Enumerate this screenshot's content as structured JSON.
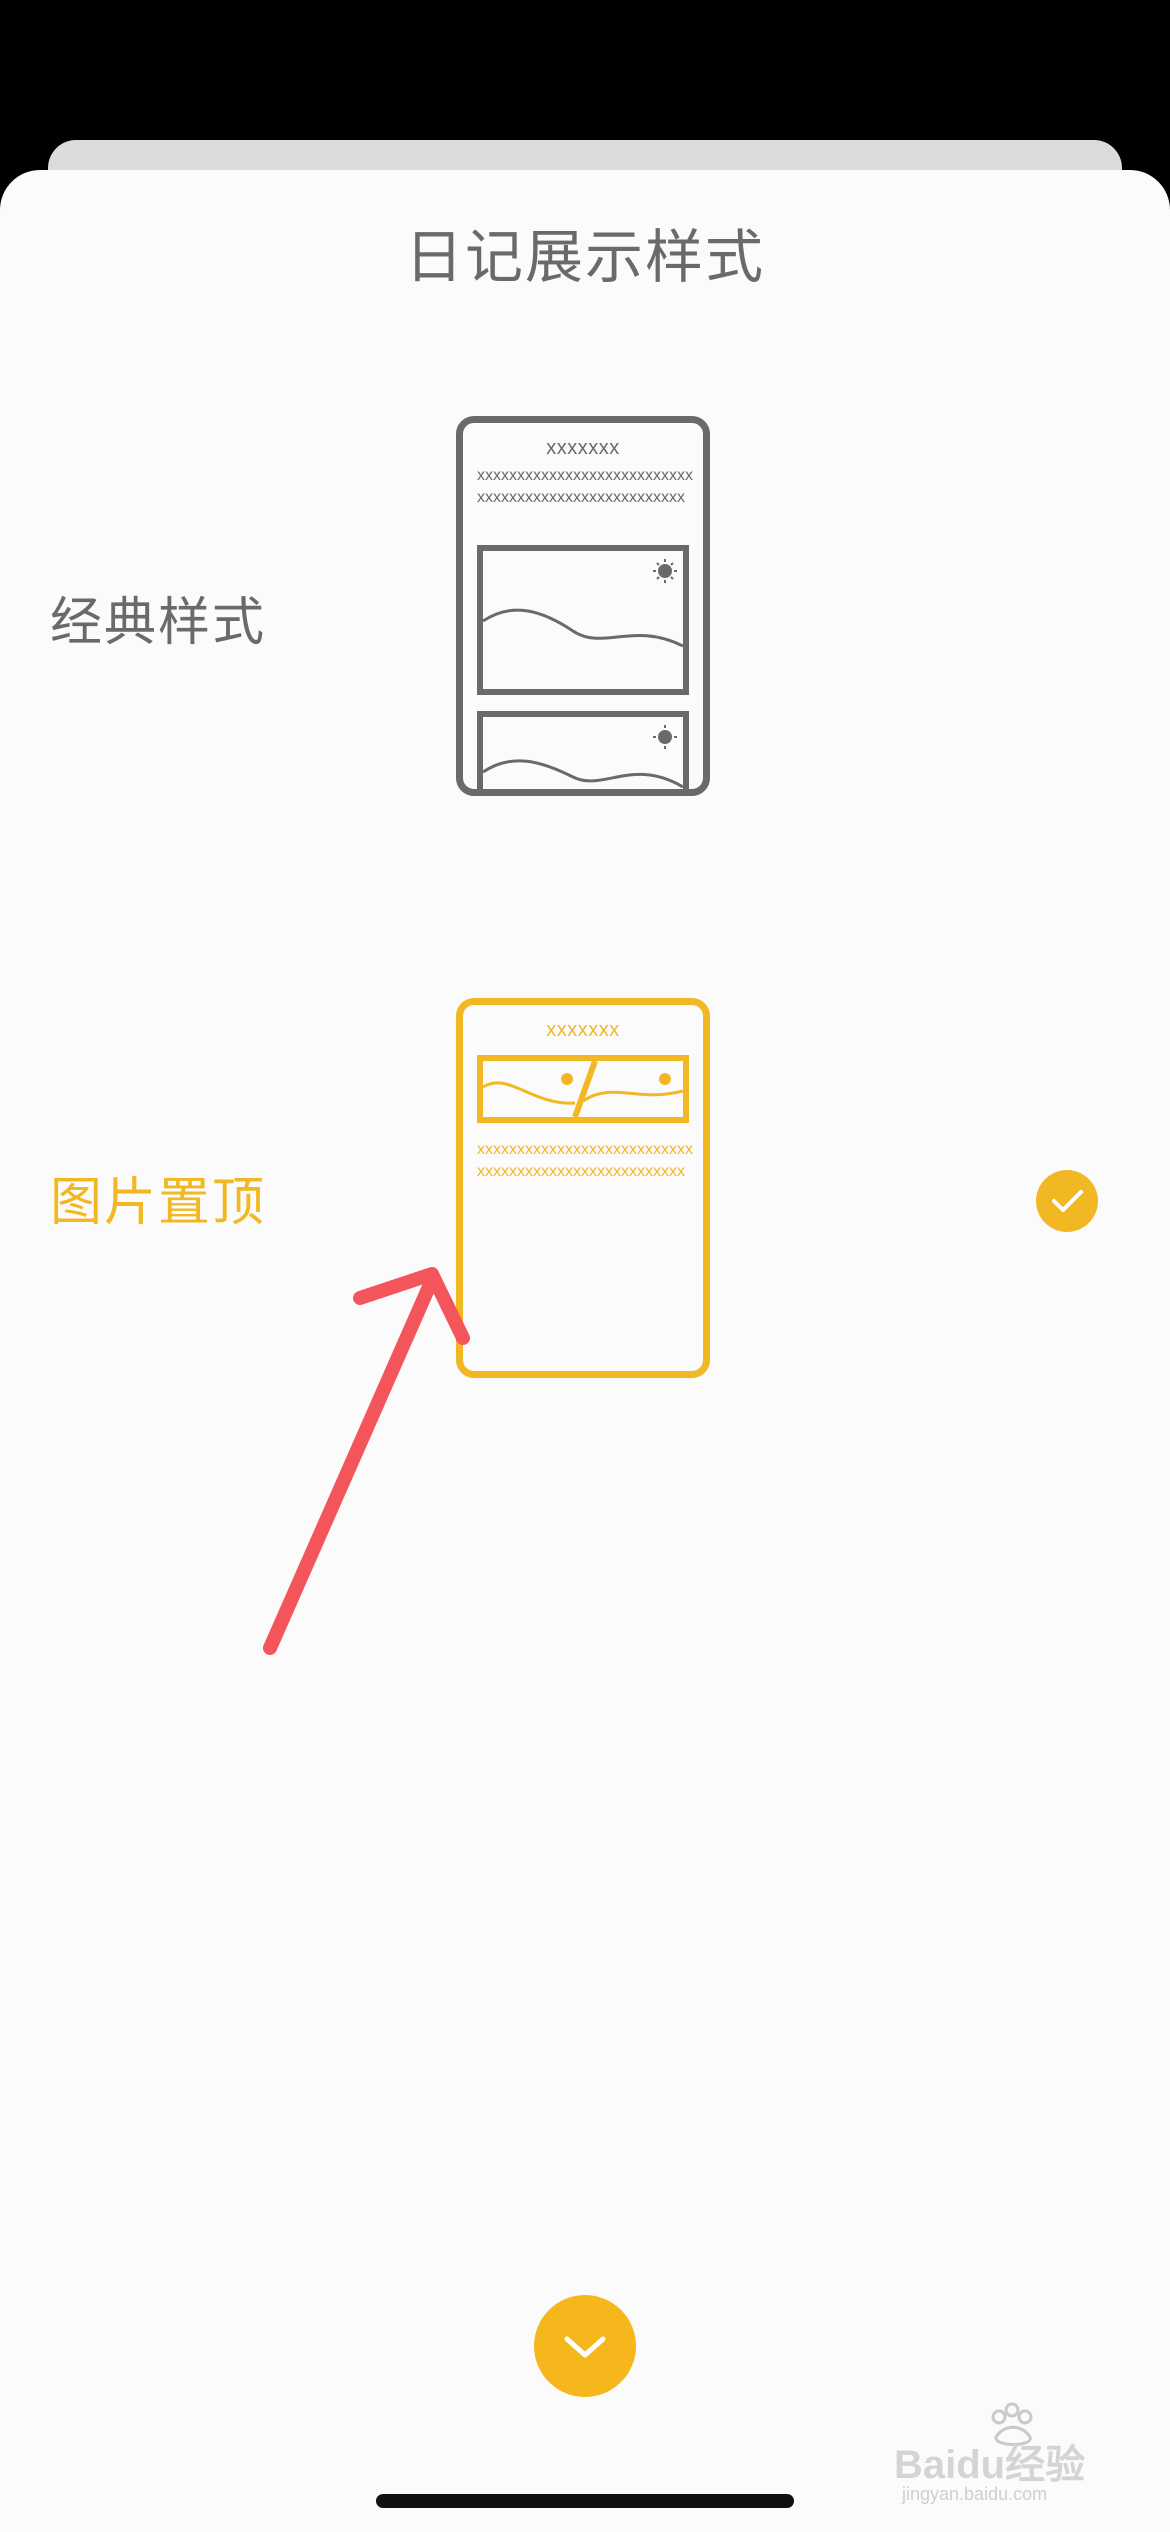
{
  "sheet": {
    "title": "日记展示样式"
  },
  "options": [
    {
      "label": "经典样式",
      "selected": false,
      "preview": {
        "title": "xxxxxxx",
        "body": "xxxxxxxxxxxxxxxxxxxxxxxxxxxxxxxxxxxxxxxxxxxxxxxxxxxxx"
      }
    },
    {
      "label": "图片置顶",
      "selected": true,
      "preview": {
        "title": "xxxxxxx",
        "body": "xxxxxxxxxxxxxxxxxxxxxxxxxxxxxxxxxxxxxxxxxxxxxxxxxxxxx"
      }
    }
  ],
  "icons": {
    "selected": "check-circle-icon",
    "collapse": "chevron-down-icon",
    "annotation": "red-arrow"
  },
  "colors": {
    "accent": "#f2b824",
    "neutral": "#6a6a6a",
    "annotation": "#f4555a"
  },
  "watermark": {
    "brand": "Baidu经验",
    "url": "jingyan.baidu.com"
  }
}
